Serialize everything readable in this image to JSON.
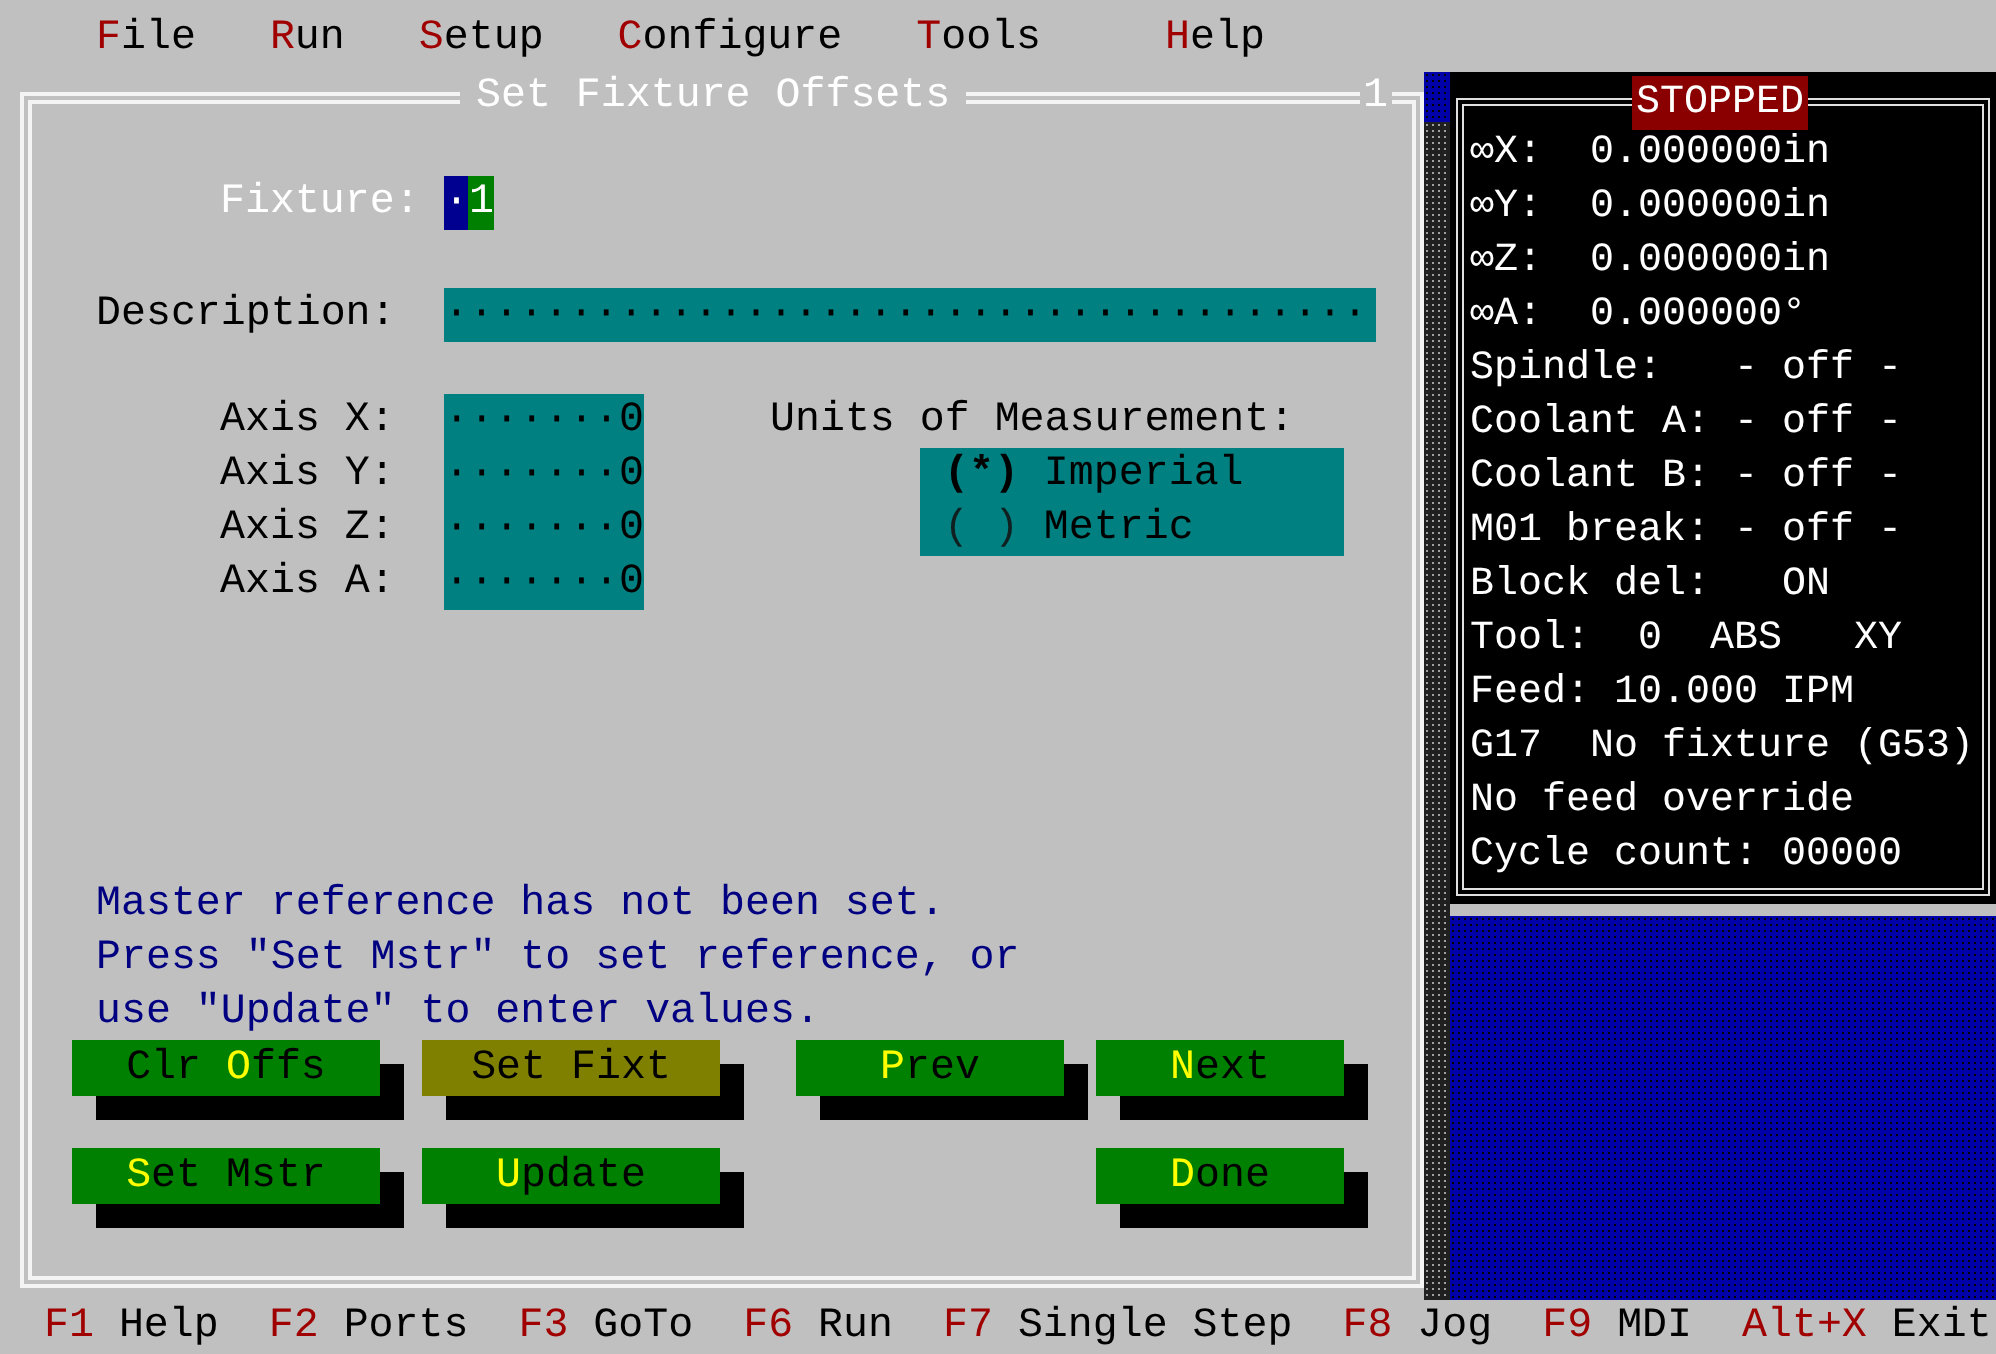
{
  "menu": [
    {
      "key": "F",
      "rest": "ile"
    },
    {
      "key": "R",
      "rest": "un"
    },
    {
      "key": "S",
      "rest": "etup"
    },
    {
      "key": "C",
      "rest": "onfigure"
    },
    {
      "key": "T",
      "rest": "ools"
    },
    {
      "key": "H",
      "rest": "elp"
    }
  ],
  "dialog": {
    "title": "Set Fixture Offsets",
    "number": "1",
    "fixture": {
      "label": "Fixture:",
      "cursor": "·",
      "value": "1"
    },
    "description": {
      "label": "Description:",
      "value": "·····································"
    },
    "axes": [
      {
        "label": "Axis X:",
        "value": "·······0"
      },
      {
        "label": "Axis Y:",
        "value": "·······0"
      },
      {
        "label": "Axis Z:",
        "value": "·······0"
      },
      {
        "label": "Axis A:",
        "value": "·······0"
      }
    ],
    "units": {
      "label": "Units of Measurement:",
      "mark_on": "(*)",
      "mark_off": "( )",
      "options": [
        {
          "label": "Imperial",
          "selected": true
        },
        {
          "label": "Metric",
          "selected": false
        }
      ]
    },
    "message": [
      "Master reference has not been set.",
      "Press \"Set Mstr\" to set reference, or",
      "use \"Update\" to enter values."
    ],
    "button_rows": [
      [
        {
          "before": "Clr ",
          "key": "O",
          "after": "ffs",
          "focused": false
        },
        {
          "before": "Set Fixt",
          "focused": true
        },
        {
          "key": "P",
          "after": "rev",
          "focused": false
        },
        {
          "key": "N",
          "after": "ext",
          "focused": false
        }
      ],
      [
        {
          "key": "S",
          "after": "et Mstr",
          "focused": false
        },
        {
          "key": "U",
          "after": "pdate",
          "focused": false
        },
        null,
        {
          "key": "D",
          "after": "one",
          "focused": false
        }
      ]
    ]
  },
  "status": {
    "title": "STOPPED",
    "lines": [
      "∞X:  0.000000in",
      "∞Y:  0.000000in",
      "∞Z:  0.000000in",
      "∞A:  0.000000°",
      "Spindle:   - off -",
      "Coolant A: - off -",
      "Coolant B: - off -",
      "M01 break: - off -",
      "Block del:   ON",
      "Tool:  0  ABS   XY",
      "Feed: 10.000 IPM",
      "G17  No fixture (G53)",
      "No feed override",
      "Cycle count: 00000"
    ]
  },
  "function_keys": [
    {
      "key": "F1",
      "label": "Help"
    },
    {
      "key": "F2",
      "label": "Ports"
    },
    {
      "key": "F3",
      "label": "GoTo"
    },
    {
      "key": "F6",
      "label": "Run"
    },
    {
      "key": "F7",
      "label": "Single Step"
    },
    {
      "key": "F8",
      "label": "Jog"
    },
    {
      "key": "F9",
      "label": "MDI"
    },
    {
      "key": "Alt+X",
      "label": "Exit"
    }
  ]
}
